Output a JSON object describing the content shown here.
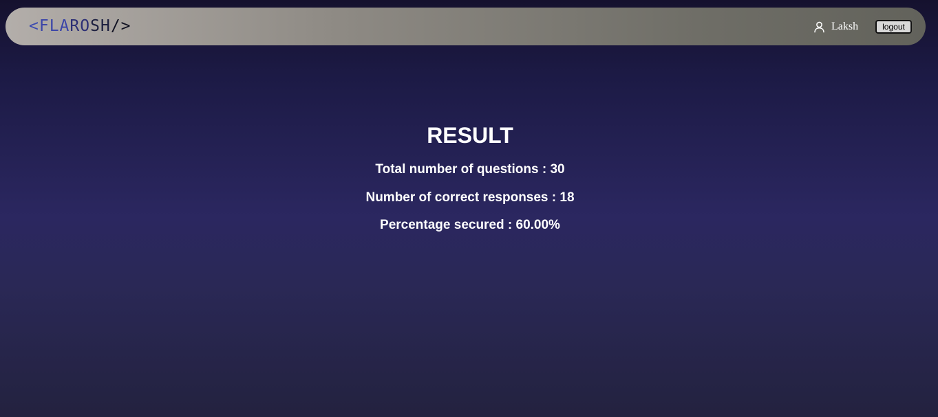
{
  "navbar": {
    "logo": {
      "open": "<",
      "brand_part1": "FLA",
      "brand_part2": "RO",
      "brand_part3": "SH",
      "close": "/>"
    },
    "user": {
      "icon": "user-icon",
      "name": "Laksh"
    },
    "logout_label": "logout"
  },
  "result": {
    "title": "RESULT",
    "total_questions": "Total number of questions : 30",
    "correct_responses": "Number of correct responses : 18",
    "percentage": "Percentage secured : 60.00%"
  },
  "colors": {
    "background_top": "#15112e",
    "background_mid": "#2b2760",
    "background_bottom": "#23223f",
    "navbar_left": "#b3aeaa",
    "navbar_right": "#62625b",
    "logo_accent": "#3d4bb0",
    "text": "#ffffff"
  }
}
